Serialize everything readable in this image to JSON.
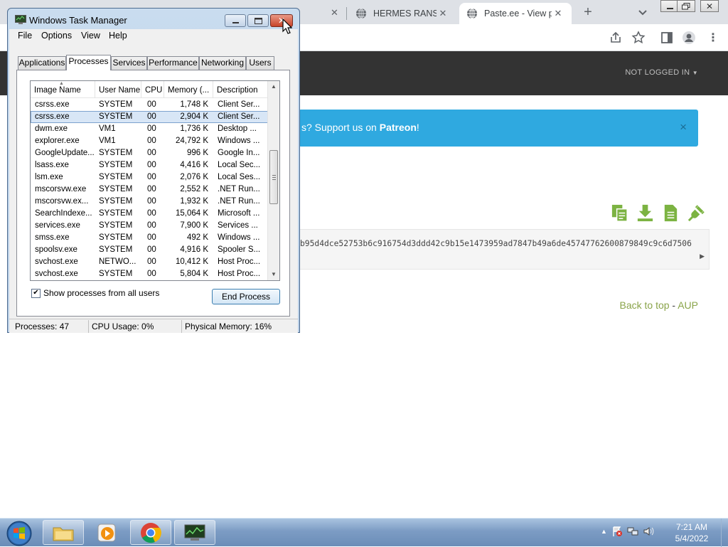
{
  "browser": {
    "tabs": [
      {
        "title": "HERMES RANSOM",
        "active": false
      },
      {
        "title": "Paste.ee - View paste",
        "active": true
      }
    ],
    "not_logged_in": "NOT LOGGED IN"
  },
  "page": {
    "banner_prefix": "s? Support us on ",
    "banner_link": "Patreon",
    "banner_suffix": "!",
    "banner_close": "×",
    "paste_text": "b95d4dce52753b6c916754d3ddd42c9b15e1473959ad7847b49a6de45747762600879849c9c6d7506",
    "footer": {
      "back_to_top": "Back to top",
      "separator": " - ",
      "aup": "AUP"
    }
  },
  "task_manager": {
    "title": "Windows Task Manager",
    "menu": [
      "File",
      "Options",
      "View",
      "Help"
    ],
    "tabs": [
      "Applications",
      "Processes",
      "Services",
      "Performance",
      "Networking",
      "Users"
    ],
    "active_tab": "Processes",
    "columns": [
      "Image Name",
      "User Name",
      "CPU",
      "Memory (...",
      "Description"
    ],
    "processes": [
      {
        "name": "csrss.exe",
        "user": "SYSTEM",
        "cpu": "00",
        "mem": "1,748 K",
        "desc": "Client Ser..."
      },
      {
        "name": "csrss.exe",
        "user": "SYSTEM",
        "cpu": "00",
        "mem": "2,904 K",
        "desc": "Client Ser...",
        "selected": true
      },
      {
        "name": "dwm.exe",
        "user": "VM1",
        "cpu": "00",
        "mem": "1,736 K",
        "desc": "Desktop ..."
      },
      {
        "name": "explorer.exe",
        "user": "VM1",
        "cpu": "00",
        "mem": "24,792 K",
        "desc": "Windows ..."
      },
      {
        "name": "GoogleUpdate...",
        "user": "SYSTEM",
        "cpu": "00",
        "mem": "996 K",
        "desc": "Google In..."
      },
      {
        "name": "lsass.exe",
        "user": "SYSTEM",
        "cpu": "00",
        "mem": "4,416 K",
        "desc": "Local Sec..."
      },
      {
        "name": "lsm.exe",
        "user": "SYSTEM",
        "cpu": "00",
        "mem": "2,076 K",
        "desc": "Local Ses..."
      },
      {
        "name": "mscorsvw.exe",
        "user": "SYSTEM",
        "cpu": "00",
        "mem": "2,552 K",
        "desc": ".NET Run..."
      },
      {
        "name": "mscorsvw.ex...",
        "user": "SYSTEM",
        "cpu": "00",
        "mem": "1,932 K",
        "desc": ".NET Run..."
      },
      {
        "name": "SearchIndexe...",
        "user": "SYSTEM",
        "cpu": "00",
        "mem": "15,064 K",
        "desc": "Microsoft ..."
      },
      {
        "name": "services.exe",
        "user": "SYSTEM",
        "cpu": "00",
        "mem": "7,900 K",
        "desc": "Services ..."
      },
      {
        "name": "smss.exe",
        "user": "SYSTEM",
        "cpu": "00",
        "mem": "492 K",
        "desc": "Windows ..."
      },
      {
        "name": "spoolsv.exe",
        "user": "SYSTEM",
        "cpu": "00",
        "mem": "4,916 K",
        "desc": "Spooler S..."
      },
      {
        "name": "svchost.exe",
        "user": "NETWO...",
        "cpu": "00",
        "mem": "10,412 K",
        "desc": "Host Proc..."
      },
      {
        "name": "svchost.exe",
        "user": "SYSTEM",
        "cpu": "00",
        "mem": "5,804 K",
        "desc": "Host Proc..."
      }
    ],
    "show_all_label": "Show processes from all users",
    "show_all_checked": true,
    "end_process": "End Process",
    "status": {
      "processes": "Processes: 47",
      "cpu": "CPU Usage: 0%",
      "memory": "Physical Memory: 16%"
    }
  },
  "taskbar": {
    "apps": [
      "windows-explorer",
      "media-player",
      "google-chrome",
      "task-manager"
    ],
    "time": "7:21 AM",
    "date": "5/4/2022"
  },
  "colors": {
    "banner": "#2fa9e0",
    "header": "#333333",
    "link_green": "#8aa44a",
    "icon_green": "#7cb342"
  }
}
